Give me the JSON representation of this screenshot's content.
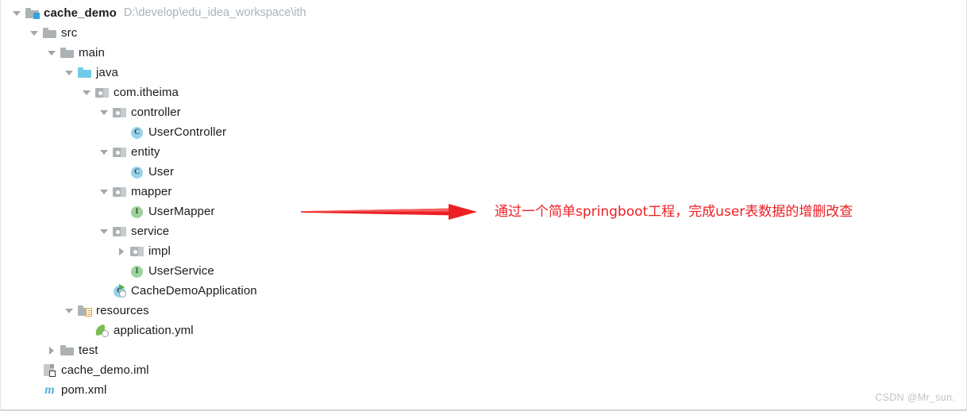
{
  "project": {
    "root_path": "D:\\develop\\edu_idea_workspace\\ith",
    "tree": [
      {
        "label": "cache_demo",
        "indent": 0,
        "twisty": "open",
        "icon": "module-folder-icon",
        "bold": true
      },
      {
        "label": "src",
        "indent": 1,
        "twisty": "open",
        "icon": "folder-icon",
        "bold": false
      },
      {
        "label": "main",
        "indent": 2,
        "twisty": "open",
        "icon": "folder-icon",
        "bold": false
      },
      {
        "label": "java",
        "indent": 3,
        "twisty": "open",
        "icon": "source-root-folder-icon",
        "bold": false
      },
      {
        "label": "com.itheima",
        "indent": 4,
        "twisty": "open",
        "icon": "package-icon",
        "bold": false
      },
      {
        "label": "controller",
        "indent": 5,
        "twisty": "open",
        "icon": "package-icon",
        "bold": false
      },
      {
        "label": "UserController",
        "indent": 6,
        "twisty": "none",
        "icon": "class-icon",
        "bold": false
      },
      {
        "label": "entity",
        "indent": 5,
        "twisty": "open",
        "icon": "package-icon",
        "bold": false
      },
      {
        "label": "User",
        "indent": 6,
        "twisty": "none",
        "icon": "class-icon",
        "bold": false
      },
      {
        "label": "mapper",
        "indent": 5,
        "twisty": "open",
        "icon": "package-icon",
        "bold": false
      },
      {
        "label": "UserMapper",
        "indent": 6,
        "twisty": "none",
        "icon": "interface-icon",
        "bold": false
      },
      {
        "label": "service",
        "indent": 5,
        "twisty": "open",
        "icon": "package-icon",
        "bold": false
      },
      {
        "label": "impl",
        "indent": 6,
        "twisty": "closed",
        "icon": "package-icon",
        "bold": false
      },
      {
        "label": "UserService",
        "indent": 6,
        "twisty": "none",
        "icon": "interface-icon",
        "bold": false
      },
      {
        "label": "CacheDemoApplication",
        "indent": 5,
        "twisty": "none",
        "icon": "runnable-class-icon",
        "bold": false
      },
      {
        "label": "resources",
        "indent": 3,
        "twisty": "open",
        "icon": "resources-folder-icon",
        "bold": false
      },
      {
        "label": "application.yml",
        "indent": 4,
        "twisty": "none",
        "icon": "spring-config-icon",
        "bold": false
      },
      {
        "label": "test",
        "indent": 2,
        "twisty": "closed",
        "icon": "folder-icon",
        "bold": false
      },
      {
        "label": "cache_demo.iml",
        "indent": 1,
        "twisty": "none",
        "icon": "iml-file-icon",
        "bold": false
      },
      {
        "label": "pom.xml",
        "indent": 1,
        "twisty": "none",
        "icon": "maven-file-icon",
        "bold": false
      }
    ]
  },
  "annotation": {
    "text": "通过一个简单springboot工程，完成user表数据的增删改查",
    "color": "#ec2024",
    "arrow_name": "red-arrow-right"
  },
  "watermark": {
    "text": "CSDN @Mr_sun."
  },
  "colors": {
    "folder_grey": "#adb2b5",
    "folder_cyan": "#70cce6",
    "class_blue": "#96d4ea",
    "interface_green": "#9bd49b",
    "maven_cyan": "#4fb3e0",
    "path_grey": "#a9b3bb",
    "text": "#1b1b1b",
    "accent_red": "#ec2024"
  }
}
